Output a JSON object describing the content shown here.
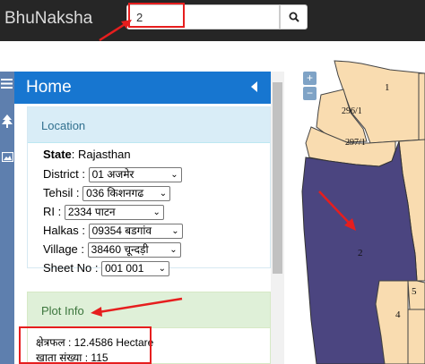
{
  "header": {
    "brand": "BhuNaksha",
    "search_value": "2",
    "search_icon": "magnifier"
  },
  "panel": {
    "title": "Home",
    "location_heading": "Location",
    "state_label": "State",
    "state_value": ": Rajasthan",
    "fields": [
      {
        "label": "District :",
        "value": "01 अजमेर"
      },
      {
        "label": "Tehsil :",
        "value": "036 किशनगढ"
      },
      {
        "label": "RI :",
        "value": "2334 पाटन"
      },
      {
        "label": "Halkas :",
        "value": "09354 बडगांव"
      },
      {
        "label": "Village :",
        "value": "38460 चून्दड़ी"
      },
      {
        "label": "Sheet No :",
        "value": "001 001"
      }
    ],
    "plot_heading": "Plot Info",
    "area_line": "क्षेत्रफल : 12.4586 Hectare",
    "khata_line": "खाता संख्या : 115"
  },
  "map": {
    "zoom_in": "+",
    "zoom_out": "−",
    "plots": [
      "1",
      "296/1",
      "297/1",
      "2",
      "5",
      "4"
    ],
    "highlight_color": "#4b4580",
    "parcel_color": "#f9dcb0"
  },
  "colors": {
    "topbar": "#262626",
    "panel_header": "#1776d0",
    "annotation": "#e61e1e"
  }
}
